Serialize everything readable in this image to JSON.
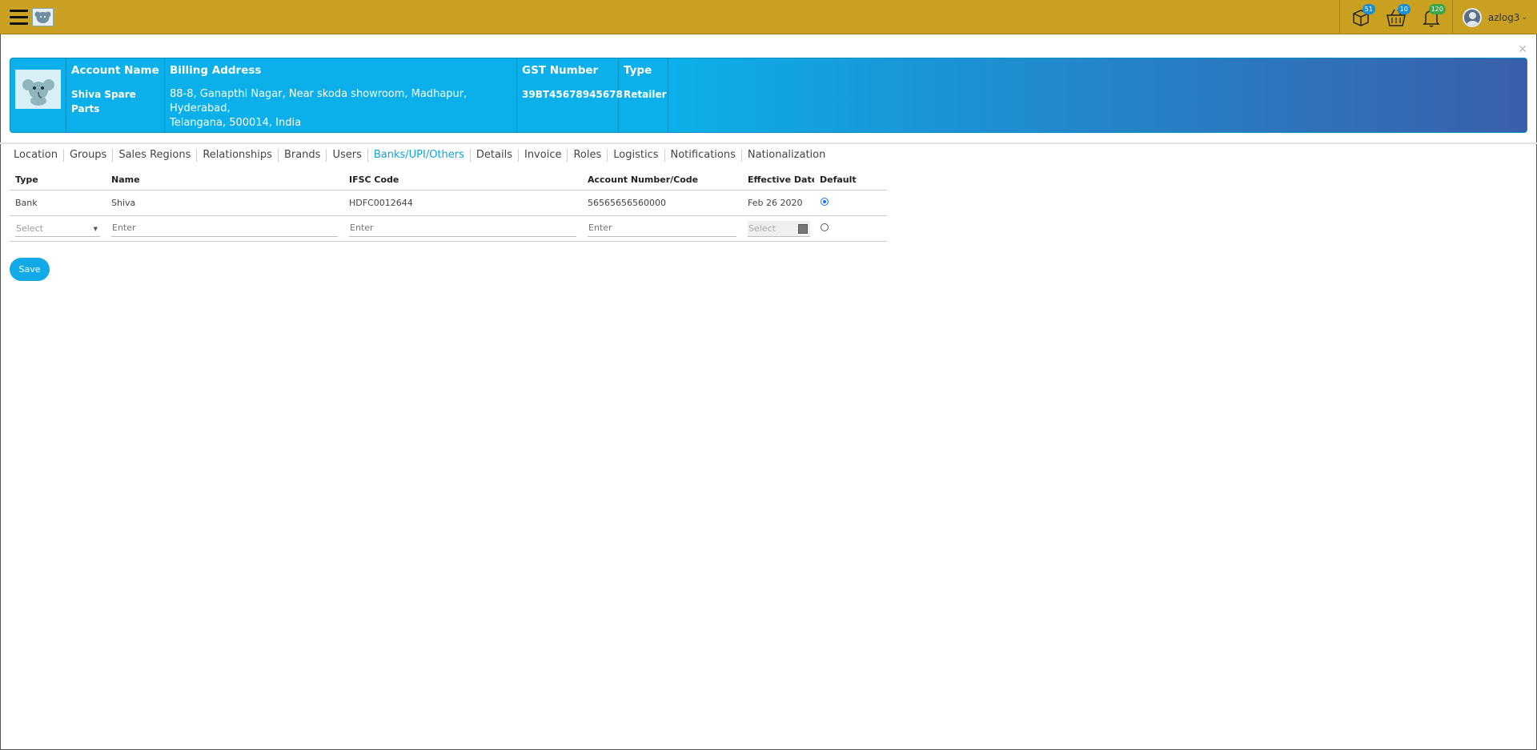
{
  "topbar": {
    "badges": {
      "packages": "51",
      "cart": "10",
      "notifications": "120"
    },
    "username": "azlog3",
    "accent_color": "#c9a020"
  },
  "account": {
    "headers": {
      "name": "Account Name",
      "address": "Billing Address",
      "gst": "GST Number",
      "type": "Type"
    },
    "name": "Shiva Spare Parts",
    "address_line1": "88-8, Ganapthi Nagar, Near skoda showroom, Madhapur,",
    "address_line2": "Hyderabad,",
    "address_line3": "Telangana, 500014, India",
    "gst": "39BT45678945678",
    "type": "Retailer"
  },
  "tabs": [
    {
      "label": "Location"
    },
    {
      "label": "Groups"
    },
    {
      "label": "Sales Regions"
    },
    {
      "label": "Relationships"
    },
    {
      "label": "Brands"
    },
    {
      "label": "Users"
    },
    {
      "label": "Banks/UPI/Others",
      "active": true
    },
    {
      "label": "Details"
    },
    {
      "label": "Invoice"
    },
    {
      "label": "Roles"
    },
    {
      "label": "Logistics"
    },
    {
      "label": "Notifications"
    },
    {
      "label": "Nationalization"
    }
  ],
  "table": {
    "columns": [
      "Type",
      "Name",
      "IFSC Code",
      "Account Number/Code",
      "Effective Date",
      "Default"
    ],
    "rows": [
      {
        "type": "Bank",
        "name": "Shiva",
        "ifsc": "HDFC0012644",
        "account": "56565656560000",
        "date": "Feb 26 2020",
        "default": true
      }
    ],
    "new_row": {
      "type_placeholder": "Select",
      "name_placeholder": "Enter",
      "ifsc_placeholder": "Enter",
      "account_placeholder": "Enter",
      "date_placeholder": "Select"
    }
  },
  "save_label": "Save"
}
